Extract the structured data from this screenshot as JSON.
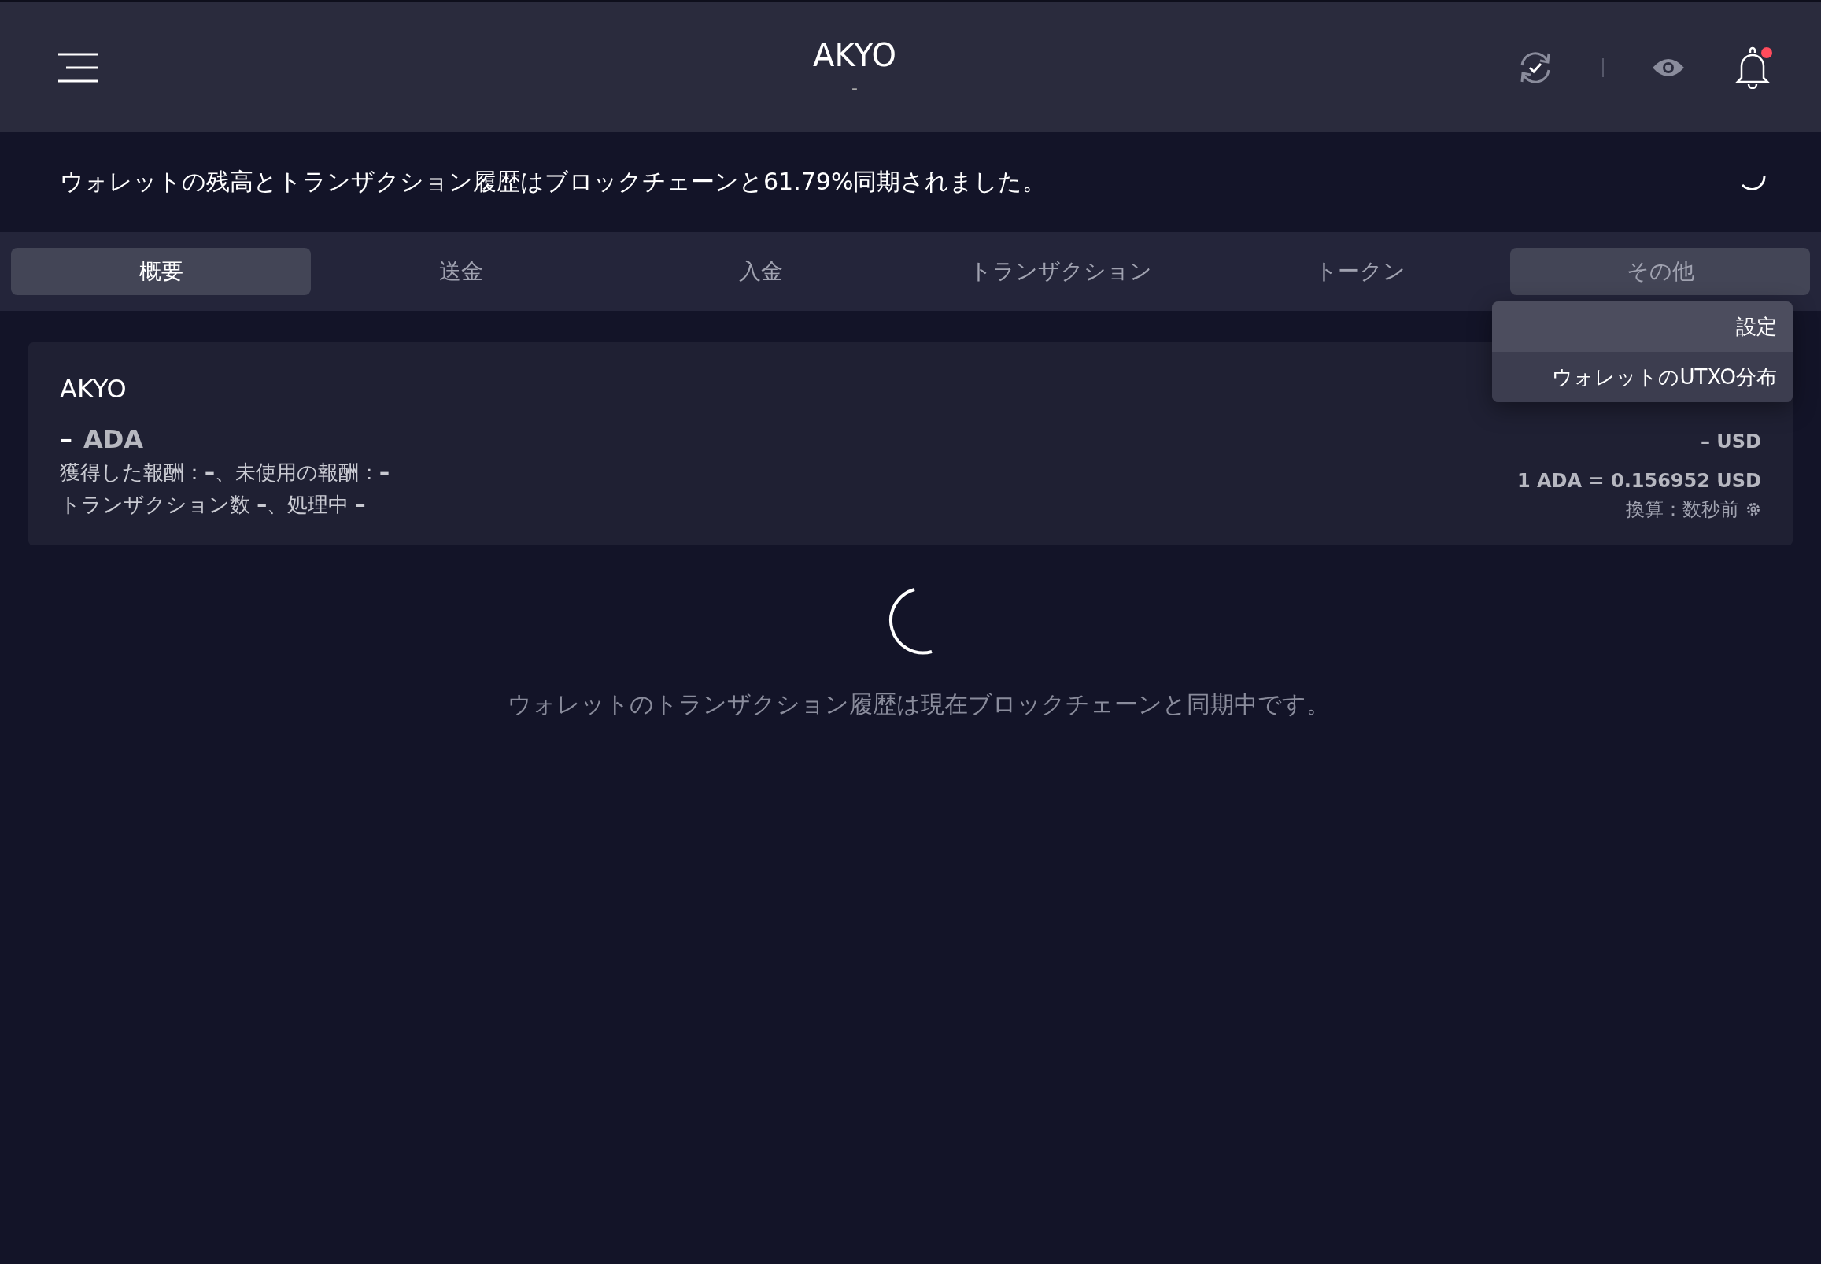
{
  "header": {
    "title": "AKYO",
    "subtitle": "-",
    "notification_unread": true
  },
  "sync_banner": {
    "message": "ウォレットの残高とトランザクション履歴はブロックチェーンと61.79%同期されました。"
  },
  "tabs": [
    {
      "label": "概要",
      "selected": true,
      "open": false
    },
    {
      "label": "送金",
      "selected": false,
      "open": false
    },
    {
      "label": "入金",
      "selected": false,
      "open": false
    },
    {
      "label": "トランザクション",
      "selected": false,
      "open": false
    },
    {
      "label": "トークン",
      "selected": false,
      "open": false
    },
    {
      "label": "その他",
      "selected": false,
      "open": true
    }
  ],
  "menu": {
    "items": [
      {
        "label": "設定",
        "highlighted": true
      },
      {
        "label": "ウォレットのUTXO分布",
        "highlighted": false
      }
    ]
  },
  "wallet_card": {
    "name": "AKYO",
    "balance_value": "–",
    "balance_unit": "ADA",
    "rewards_line": "獲得した報酬：**–**、未使用の報酬：**–**",
    "transactions_line": "トランザクション数 **–**、処理中 **–**",
    "fiat_balance": "**–** USD",
    "rate": "1 ADA = 0.156952 USD",
    "updated": "換算：数秒前"
  },
  "sync_status": {
    "message": "ウォレットのトランザクション履歴は現在ブロックチェーンと同期中です。"
  }
}
